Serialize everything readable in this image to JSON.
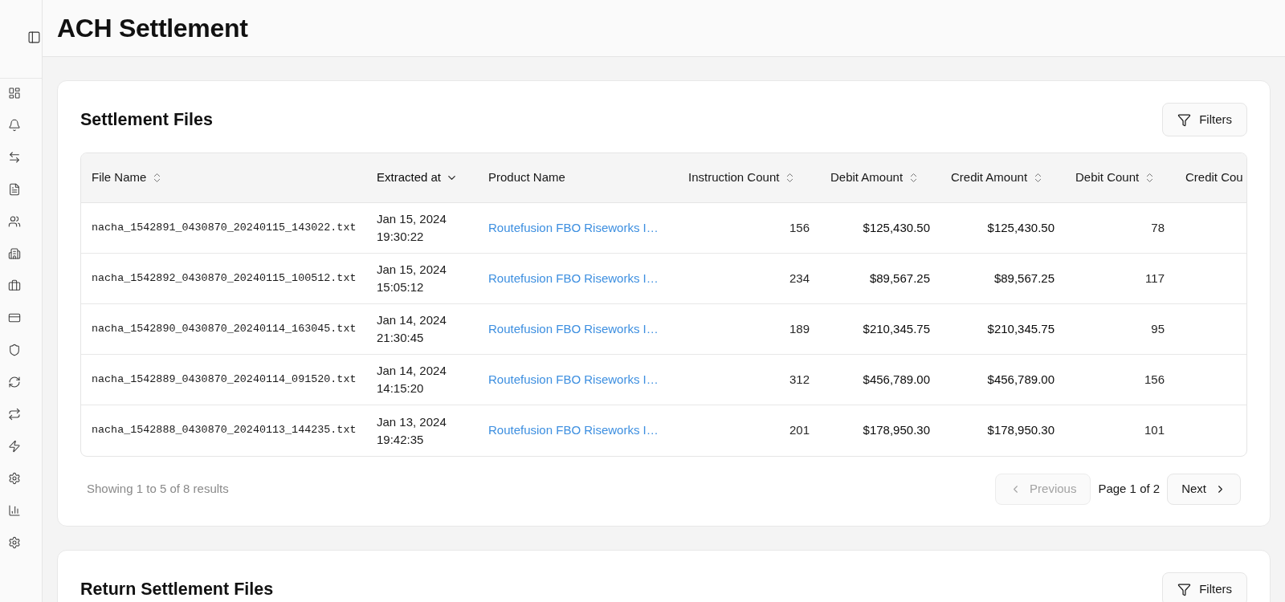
{
  "page": {
    "title": "ACH Settlement"
  },
  "settlement_files": {
    "title": "Settlement Files",
    "filter_button": "Filters",
    "columns": [
      {
        "label": "File Name",
        "kind": "mono",
        "sortable": true,
        "sorted": false
      },
      {
        "label": "Extracted at",
        "kind": "datetime",
        "sortable": true,
        "sorted": true
      },
      {
        "label": "Product Name",
        "kind": "link",
        "sortable": false
      },
      {
        "label": "Instruction Count",
        "kind": "number",
        "sortable": true,
        "sorted": false
      },
      {
        "label": "Debit Amount",
        "kind": "amount",
        "sortable": true,
        "sorted": false
      },
      {
        "label": "Credit Amount",
        "kind": "amount",
        "sortable": true,
        "sorted": false
      },
      {
        "label": "Debit Count",
        "kind": "number",
        "sortable": true,
        "sorted": false
      },
      {
        "label": "Credit Cou"
      }
    ],
    "rows": [
      {
        "cells": [
          "nacha_1542891_0430870_20240115_143022.txt",
          "Jan 15, 2024 19:30:22",
          "Routefusion FBO Riseworks I…",
          "156",
          "$125,430.50",
          "$125,430.50",
          "78"
        ]
      },
      {
        "cells": [
          "nacha_1542892_0430870_20240115_100512.txt",
          "Jan 15, 2024 15:05:12",
          "Routefusion FBO Riseworks I…",
          "234",
          "$89,567.25",
          "$89,567.25",
          "117"
        ]
      },
      {
        "cells": [
          "nacha_1542890_0430870_20240114_163045.txt",
          "Jan 14, 2024 21:30:45",
          "Routefusion FBO Riseworks I…",
          "189",
          "$210,345.75",
          "$210,345.75",
          "95"
        ]
      },
      {
        "cells": [
          "nacha_1542889_0430870_20240114_091520.txt",
          "Jan 14, 2024 14:15:20",
          "Routefusion FBO Riseworks I…",
          "312",
          "$456,789.00",
          "$456,789.00",
          "156"
        ]
      },
      {
        "cells": [
          "nacha_1542888_0430870_20240113_144235.txt",
          "Jan 13, 2024 19:42:35",
          "Routefusion FBO Riseworks I…",
          "201",
          "$178,950.30",
          "$178,950.30",
          "101"
        ]
      }
    ],
    "pagination": {
      "summary": "Showing 1 to 5 of 8 results",
      "previous": {
        "label": "Previous",
        "disabled": true
      },
      "page_label": "Page 1 of 2",
      "next": {
        "label": "Next",
        "disabled": false
      }
    }
  },
  "return_settlement_files": {
    "title": "Return Settlement Files",
    "filter_button": "Filters"
  }
}
